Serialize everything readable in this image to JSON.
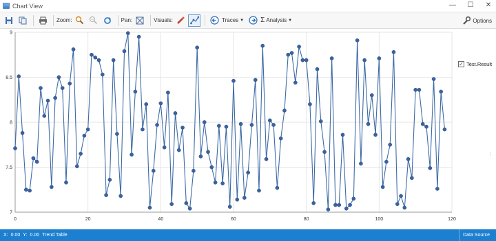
{
  "window": {
    "title": "Chart View",
    "minimize": "—",
    "maximize": "☐",
    "close": "✕"
  },
  "toolbar": {
    "zoom_label": "Zoom:",
    "pan_label": "Pan:",
    "visuals_label": "Visuals:",
    "traces_label": "Traces",
    "analysis_label": "Analysis",
    "options_label": "Options"
  },
  "legend": {
    "series_name": "Test.Result",
    "checked": true
  },
  "status": {
    "x_label": "X:",
    "x_value": "0.00",
    "y_label": "Y:",
    "y_value": "0.00",
    "trend_table": "Trend Table",
    "data_source": "Data Source"
  },
  "colors": {
    "line": "#3d6aa6",
    "marker": "#3a62a0",
    "accent": "#1c7fd0"
  },
  "chart_data": {
    "type": "line",
    "title": "",
    "xlabel": "",
    "ylabel": "",
    "xlim": [
      0,
      120
    ],
    "ylim": [
      7,
      9
    ],
    "x_ticks": [
      0,
      20,
      40,
      60,
      80,
      100,
      120
    ],
    "y_ticks": [
      7,
      7.5,
      8,
      8.5,
      9
    ],
    "grid": true,
    "legend_position": "top-right",
    "series": [
      {
        "name": "Test.Result",
        "marker": "circle",
        "values": [
          7.71,
          8.51,
          7.88,
          7.25,
          7.24,
          7.6,
          7.56,
          8.38,
          8.07,
          8.24,
          7.28,
          8.27,
          8.5,
          8.38,
          7.33,
          8.43,
          8.81,
          7.51,
          7.65,
          7.85,
          7.92,
          8.75,
          8.72,
          8.69,
          8.53,
          7.19,
          7.36,
          8.69,
          7.87,
          7.18,
          8.79,
          8.99,
          7.64,
          8.34,
          8.95,
          7.92,
          8.2,
          7.05,
          7.46,
          7.97,
          8.21,
          7.72,
          8.33,
          7.09,
          8.1,
          7.69,
          7.94,
          7.1,
          7.04,
          7.46,
          8.83,
          7.62,
          8.0,
          7.67,
          7.5,
          7.33,
          7.96,
          7.32,
          7.95,
          7.06,
          8.46,
          7.14,
          7.98,
          7.16,
          7.44,
          7.97,
          8.47,
          7.24,
          8.85,
          7.59,
          8.02,
          7.97,
          7.27,
          7.82,
          8.13,
          8.75,
          8.77,
          8.44,
          8.84,
          8.69,
          8.69,
          8.2,
          7.1,
          8.59,
          8.01,
          7.67,
          7.03,
          8.71,
          7.08,
          7.08,
          7.86,
          7.04,
          7.08,
          7.15,
          8.91,
          7.54,
          8.69,
          7.98,
          8.3,
          7.86,
          8.71,
          7.28,
          7.56,
          7.75,
          8.78,
          7.09,
          7.18,
          7.05,
          7.59,
          7.38,
          8.36,
          8.36,
          7.98,
          7.95,
          7.49,
          8.48,
          7.26,
          8.34,
          7.92
        ]
      }
    ]
  }
}
